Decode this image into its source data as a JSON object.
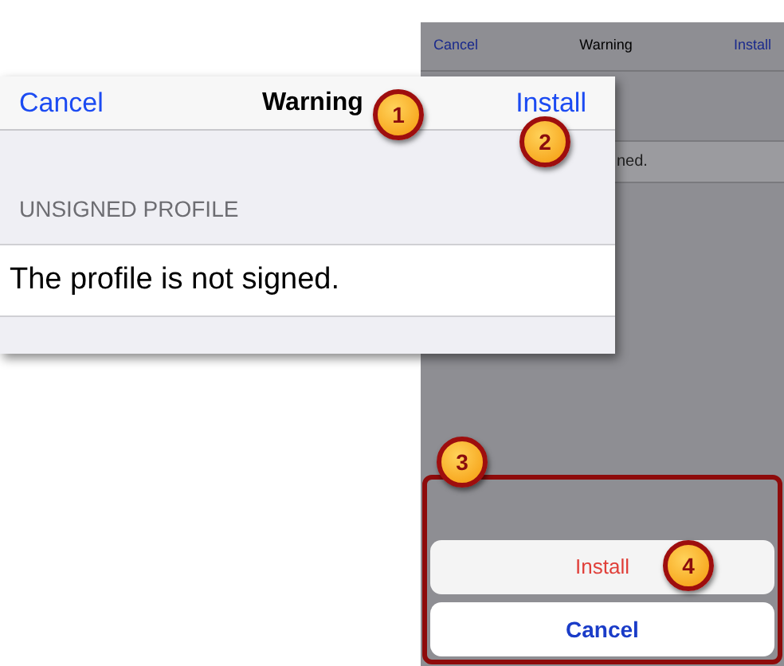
{
  "background_screen": {
    "nav_bar": {
      "cancel": "Cancel",
      "title": "Warning",
      "install": "Install"
    },
    "row_text": "ned.",
    "action_sheet": [
      {
        "label": "Install",
        "kind": "destructive"
      },
      {
        "label": "Cancel",
        "kind": "cancel"
      }
    ]
  },
  "foreground_screen": {
    "nav_bar": {
      "cancel": "Cancel",
      "title": "Warning",
      "install": "Install"
    },
    "section_header": "UNSIGNED PROFILE",
    "message": "The profile is not signed."
  },
  "callouts": [
    "1",
    "2",
    "3",
    "4"
  ]
}
